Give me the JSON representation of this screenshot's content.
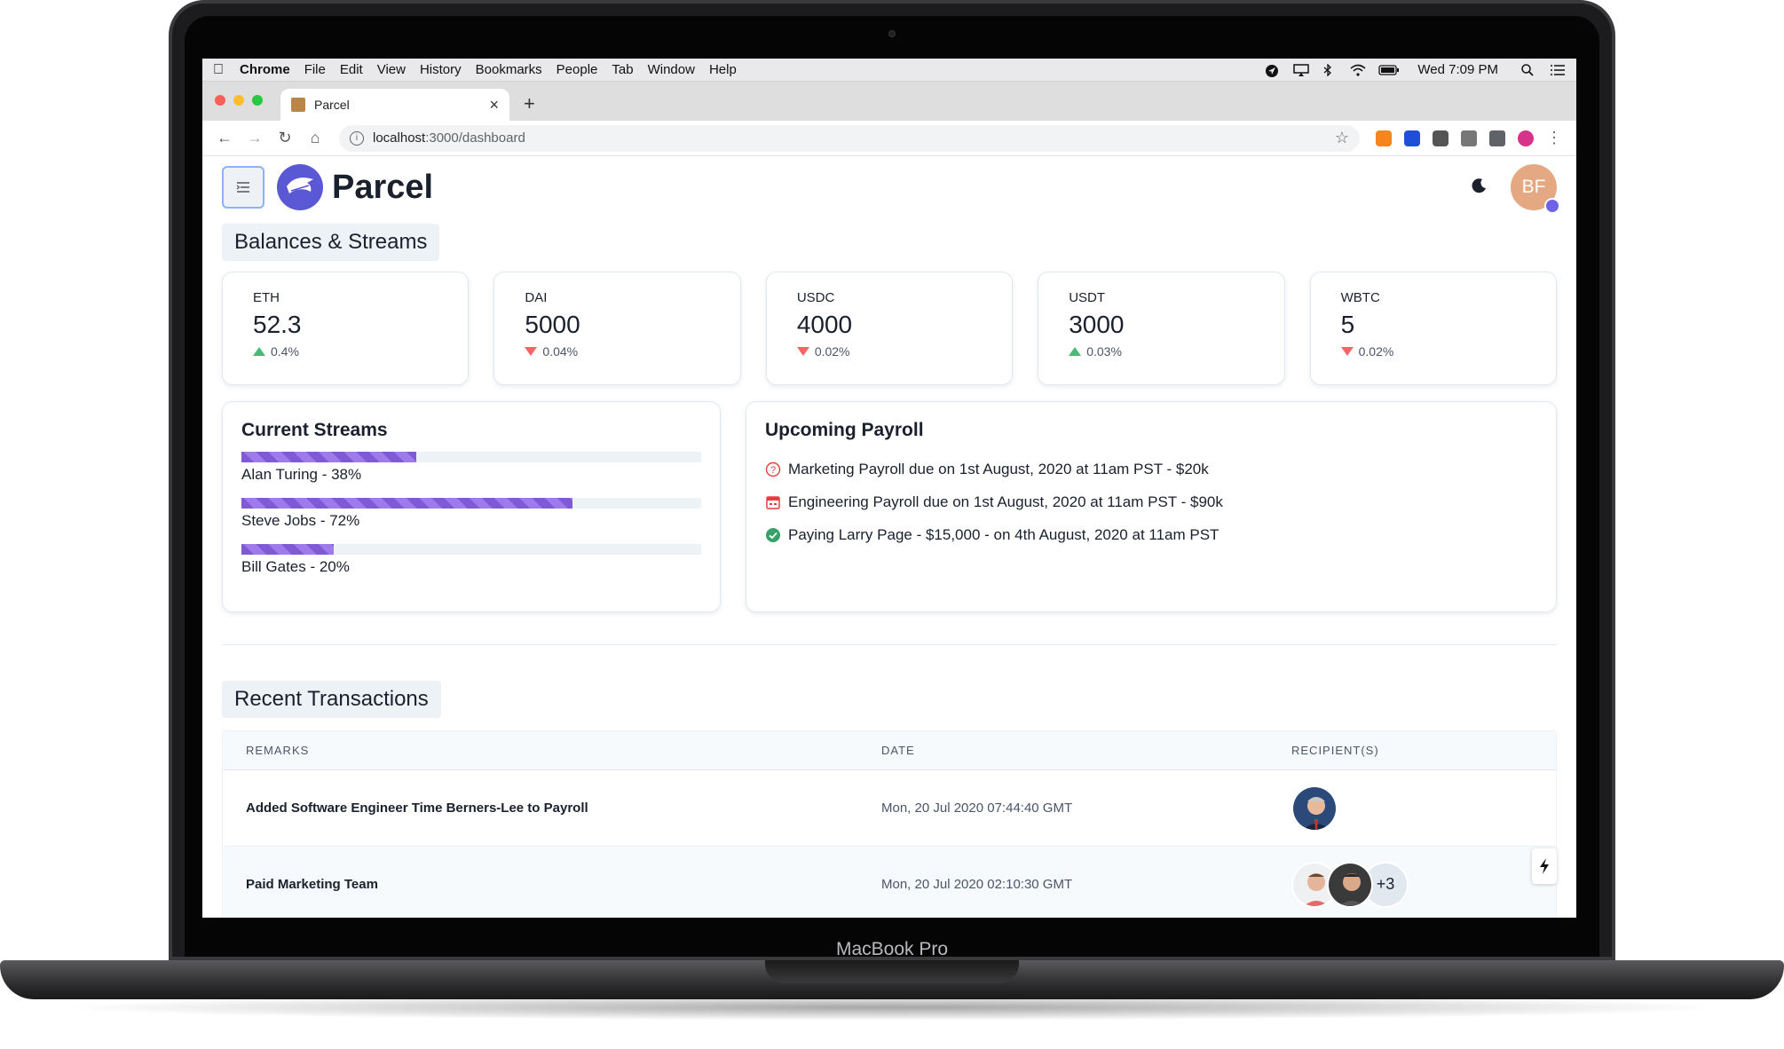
{
  "device": {
    "label": "MacBook Pro"
  },
  "menubar": {
    "app": "Chrome",
    "items": [
      "File",
      "Edit",
      "View",
      "History",
      "Bookmarks",
      "People",
      "Tab",
      "Window",
      "Help"
    ],
    "clock": "Wed 7:09 PM"
  },
  "browser": {
    "tab_title": "Parcel",
    "url_host": "localhost",
    "url_path": ":3000/dashboard"
  },
  "app": {
    "brand": "Parcel",
    "user_initials": "BF",
    "brand_color": "#5b58d6"
  },
  "balances": {
    "title": "Balances & Streams",
    "tokens": [
      {
        "symbol": "ETH",
        "value": "52.3",
        "change": "0.4%",
        "direction": "up"
      },
      {
        "symbol": "DAI",
        "value": "5000",
        "change": "0.04%",
        "direction": "down"
      },
      {
        "symbol": "USDC",
        "value": "4000",
        "change": "0.02%",
        "direction": "down"
      },
      {
        "symbol": "USDT",
        "value": "3000",
        "change": "0.03%",
        "direction": "up"
      },
      {
        "symbol": "WBTC",
        "value": "5",
        "change": "0.02%",
        "direction": "down"
      }
    ]
  },
  "streams": {
    "title": "Current Streams",
    "items": [
      {
        "label": "Alan Turing - 38%",
        "progress": 0.38
      },
      {
        "label": "Steve Jobs - 72%",
        "progress": 0.72
      },
      {
        "label": "Bill Gates - 20%",
        "progress": 0.2
      }
    ]
  },
  "payroll": {
    "title": "Upcoming Payroll",
    "items": [
      {
        "text": "Marketing Payroll due on 1st August, 2020 at 11am PST - $20k",
        "icon": "question-circle-icon"
      },
      {
        "text": "Engineering Payroll due on 1st August, 2020 at 11am PST - $90k",
        "icon": "calendar-icon"
      },
      {
        "text": "Paying Larry Page - $15,000 - on 4th August, 2020 at 11am PST",
        "icon": "check-circle-icon"
      }
    ]
  },
  "transactions": {
    "title": "Recent Transactions",
    "columns": [
      "REMARKS",
      "DATE",
      "RECIPIENT(S)"
    ],
    "rows": [
      {
        "remark": "Added Software Engineer Time Berners-Lee to Payroll",
        "date": "Mon, 20 Jul 2020 07:44:40 GMT"
      },
      {
        "remark": "Paid Marketing Team",
        "date": "Mon, 20 Jul 2020 02:10:30 GMT",
        "more": "+3"
      }
    ]
  }
}
